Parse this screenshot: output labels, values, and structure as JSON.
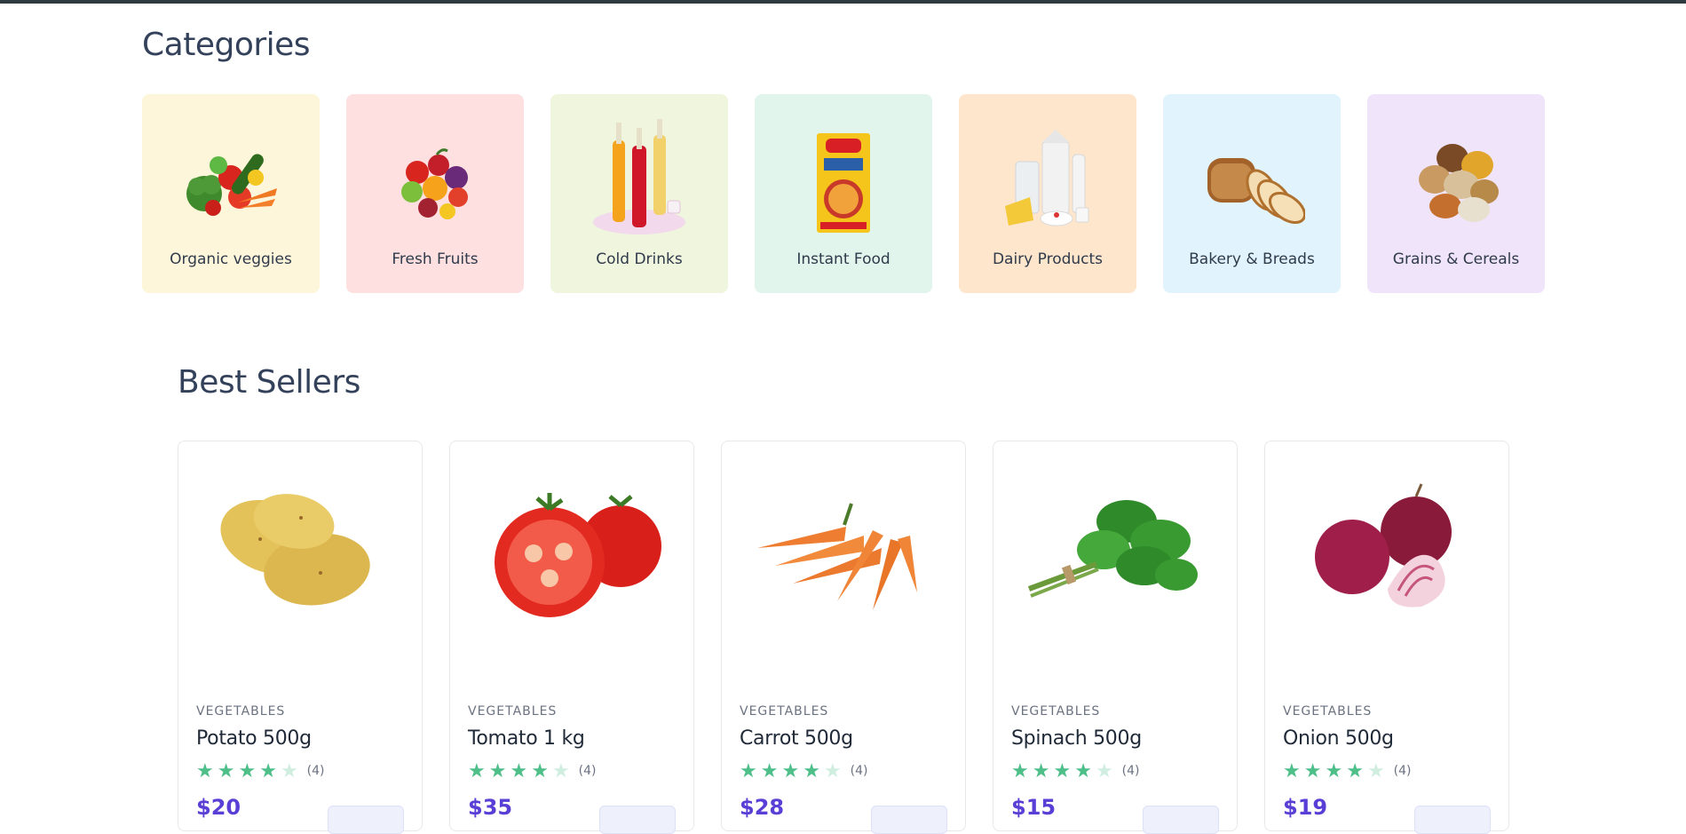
{
  "categories": {
    "title": "Categories",
    "items": [
      {
        "label": "Organic veggies",
        "bg": "#fef6da",
        "icon": "vegetables-icon"
      },
      {
        "label": "Fresh Fruits",
        "bg": "#fee0e0",
        "icon": "fruits-icon"
      },
      {
        "label": "Cold Drinks",
        "bg": "#f0f5de",
        "icon": "cold-drinks-icon"
      },
      {
        "label": "Instant Food",
        "bg": "#e1f5ec",
        "icon": "instant-noodles-icon"
      },
      {
        "label": "Dairy Products",
        "bg": "#fee6cd",
        "icon": "dairy-icon"
      },
      {
        "label": "Bakery & Breads",
        "bg": "#e1f4fd",
        "icon": "bread-icon"
      },
      {
        "label": "Grains & Cereals",
        "bg": "#f0e4fa",
        "icon": "grains-icon"
      }
    ]
  },
  "best_sellers": {
    "title": "Best Sellers",
    "products": [
      {
        "category": "VEGETABLES",
        "name": "Potato 500g",
        "rating": 4,
        "rating_text": "(4)",
        "price": "$20",
        "icon": "potato-icon"
      },
      {
        "category": "VEGETABLES",
        "name": "Tomato 1 kg",
        "rating": 4,
        "rating_text": "(4)",
        "price": "$35",
        "icon": "tomato-icon"
      },
      {
        "category": "VEGETABLES",
        "name": "Carrot 500g",
        "rating": 4,
        "rating_text": "(4)",
        "price": "$28",
        "icon": "carrot-icon"
      },
      {
        "category": "VEGETABLES",
        "name": "Spinach 500g",
        "rating": 4,
        "rating_text": "(4)",
        "price": "$15",
        "icon": "spinach-icon"
      },
      {
        "category": "VEGETABLES",
        "name": "Onion 500g",
        "rating": 4,
        "rating_text": "(4)",
        "price": "$19",
        "icon": "onion-icon"
      }
    ]
  },
  "colors": {
    "accent": "#5a3fd6",
    "star": "#4fbf8a",
    "topbar": "#2e3a40"
  }
}
